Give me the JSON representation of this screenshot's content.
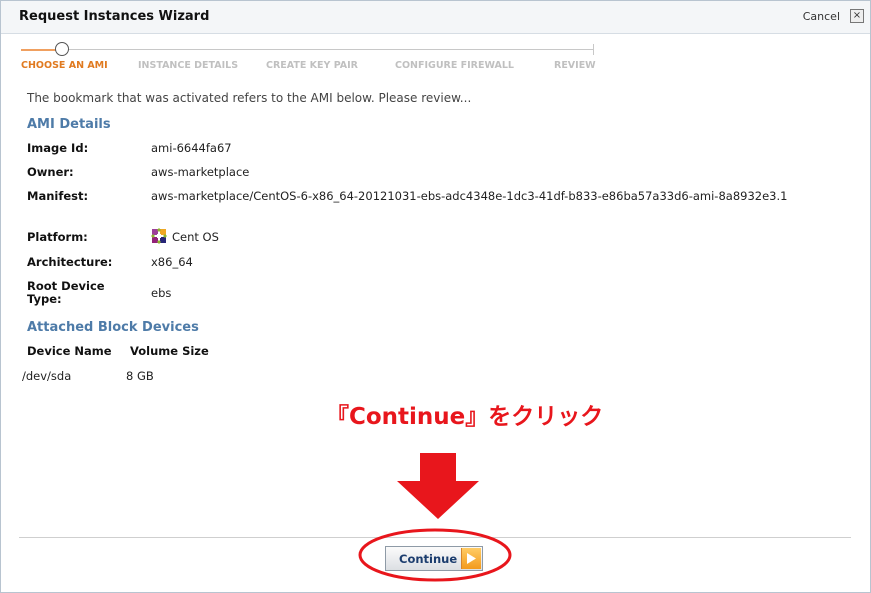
{
  "dialog": {
    "title": "Request Instances Wizard",
    "cancel_label": "Cancel",
    "close_glyph": "×"
  },
  "steps": [
    {
      "label": "CHOOSE AN AMI",
      "active": true
    },
    {
      "label": "INSTANCE DETAILS",
      "active": false
    },
    {
      "label": "CREATE KEY PAIR",
      "active": false
    },
    {
      "label": "CONFIGURE FIREWALL",
      "active": false
    },
    {
      "label": "REVIEW",
      "active": false
    }
  ],
  "intro_text": "The bookmark that was activated refers to the AMI below. Please review...",
  "ami_details": {
    "heading": "AMI Details",
    "image_id_label": "Image Id:",
    "image_id": "ami-6644fa67",
    "owner_label": "Owner:",
    "owner": "aws-marketplace",
    "manifest_label": "Manifest:",
    "manifest": "aws-marketplace/CentOS-6-x86_64-20121031-ebs-adc4348e-1dc3-41df-b833-e86ba57a33d6-ami-8a8932e3.1",
    "platform_label": "Platform:",
    "platform": "Cent OS",
    "platform_icon": "centos-logo-icon",
    "architecture_label": "Architecture:",
    "architecture": "x86_64",
    "root_device_label_line1": "Root Device",
    "root_device_label_line2": "Type:",
    "root_device": "ebs"
  },
  "block_devices": {
    "heading": "Attached Block Devices",
    "columns": [
      "Device Name",
      "Volume Size"
    ],
    "rows": [
      {
        "device": "/dev/sda",
        "size": "8 GB"
      }
    ]
  },
  "annotation": {
    "text": "『Continue』をクリック",
    "color": "#e8161c"
  },
  "footer": {
    "continue_label": "Continue"
  },
  "colors": {
    "accent_orange": "#e07a20",
    "section_blue": "#4e7ba8",
    "annotation_red": "#e8161c"
  }
}
